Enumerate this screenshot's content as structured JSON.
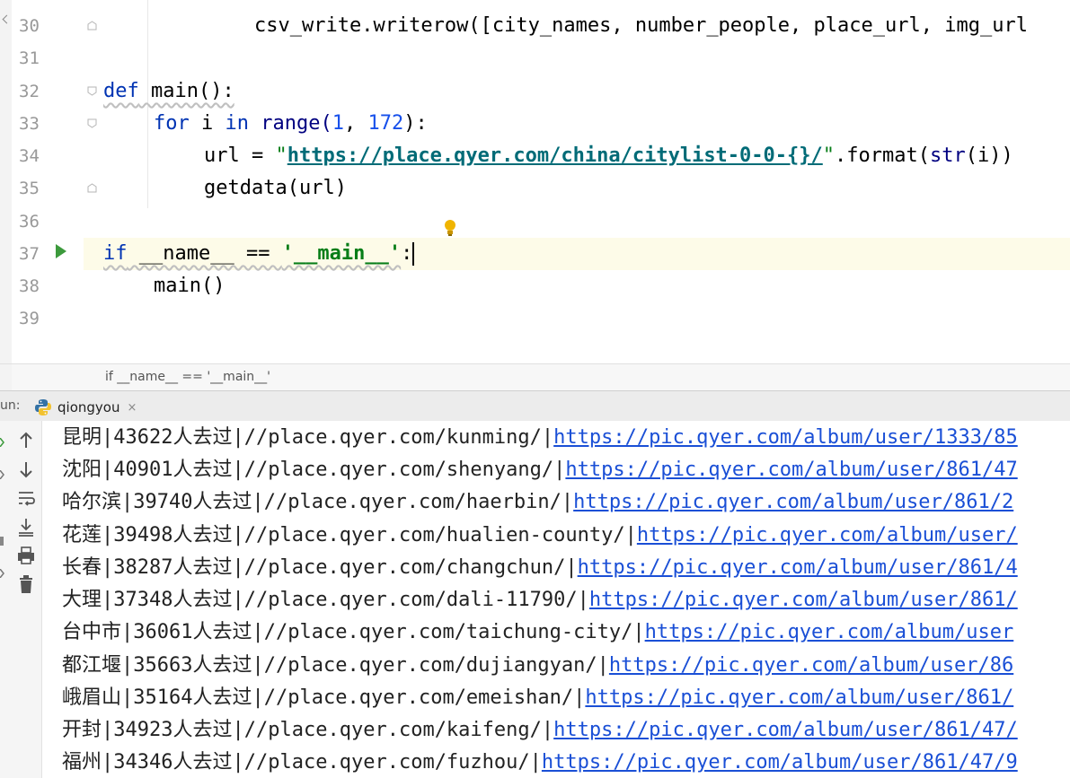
{
  "editor": {
    "lines": [
      {
        "no": "30"
      },
      {
        "no": "31"
      },
      {
        "no": "32"
      },
      {
        "no": "33"
      },
      {
        "no": "34"
      },
      {
        "no": "35"
      },
      {
        "no": "36"
      },
      {
        "no": "37"
      },
      {
        "no": "38"
      },
      {
        "no": "39"
      }
    ],
    "code": {
      "l30_a": "csv_write.writerow([city_names, number_people, place_url, img_url",
      "l32_def": "def",
      "l32_rest": " main():",
      "l33_for": "for",
      "l33_i": " i ",
      "l33_in": "in",
      "l33_range": " range(",
      "l33_n1": "1",
      "l33_sep": ", ",
      "l33_n2": "172",
      "l33_end": "):",
      "l34_a": "url = ",
      "l34_q1": "\"",
      "l34_url": "https://place.qyer.com/china/citylist-0-0-{}/",
      "l34_q2": "\"",
      "l34_b": ".format(",
      "l34_str": "str",
      "l34_c": "(i))",
      "l35": "getdata(url)",
      "l37_if": "if",
      "l37_mid": " __name__ == ",
      "l37_str": "'__main__'",
      "l37_colon": ":",
      "l38": "main()"
    }
  },
  "breadcrumb": "if __name__ == '__main__'",
  "run": {
    "label": "un:",
    "tab": "qiongyou",
    "close": "×"
  },
  "toolbar": [
    "up-arrow-icon",
    "down-arrow-icon",
    "soft-wrap-icon",
    "scroll-to-end-icon",
    "print-icon",
    "trash-icon"
  ],
  "console": {
    "rows": [
      {
        "city": "昆明",
        "count": "43622",
        "suffix": "人去过",
        "place": "//place.qyer.com/kunming/",
        "img": "https://pic.qyer.com/album/user/1333/85"
      },
      {
        "city": "沈阳",
        "count": "40901",
        "suffix": "人去过",
        "place": "//place.qyer.com/shenyang/",
        "img": "https://pic.qyer.com/album/user/861/47"
      },
      {
        "city": "哈尔滨",
        "count": "39740",
        "suffix": "人去过",
        "place": "//place.qyer.com/haerbin/",
        "img": "https://pic.qyer.com/album/user/861/2"
      },
      {
        "city": "花莲",
        "count": "39498",
        "suffix": "人去过",
        "place": "//place.qyer.com/hualien-county/",
        "img": "https://pic.qyer.com/album/user/"
      },
      {
        "city": "长春",
        "count": "38287",
        "suffix": "人去过",
        "place": "//place.qyer.com/changchun/",
        "img": "https://pic.qyer.com/album/user/861/4"
      },
      {
        "city": "大理",
        "count": "37348",
        "suffix": "人去过",
        "place": "//place.qyer.com/dali-11790/",
        "img": "https://pic.qyer.com/album/user/861/"
      },
      {
        "city": "台中市",
        "count": "36061",
        "suffix": "人去过",
        "place": "//place.qyer.com/taichung-city/",
        "img": "https://pic.qyer.com/album/user"
      },
      {
        "city": "都江堰",
        "count": "35663",
        "suffix": "人去过",
        "place": "//place.qyer.com/dujiangyan/",
        "img": "https://pic.qyer.com/album/user/86"
      },
      {
        "city": "峨眉山",
        "count": "35164",
        "suffix": "人去过",
        "place": "//place.qyer.com/emeishan/",
        "img": "https://pic.qyer.com/album/user/861/"
      },
      {
        "city": "开封",
        "count": "34923",
        "suffix": "人去过",
        "place": "//place.qyer.com/kaifeng/",
        "img": "https://pic.qyer.com/album/user/861/47/"
      },
      {
        "city": "福州",
        "count": "34346",
        "suffix": "人去过",
        "place": "//place.qyer.com/fuzhou/",
        "img": "https://pic.qyer.com/album/user/861/47/9"
      }
    ]
  },
  "colors": {
    "keyword": "#0033b3",
    "number": "#1750eb",
    "string": "#067d17",
    "link": "#1a4fd6",
    "caret_line": "#fdfbe8"
  }
}
